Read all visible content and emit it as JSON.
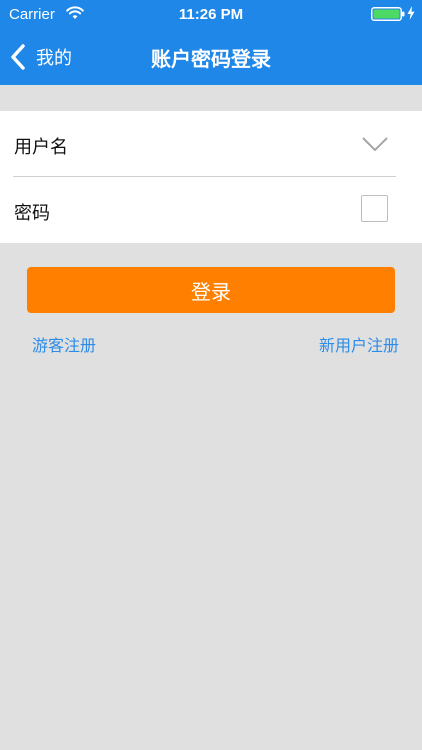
{
  "status_bar": {
    "carrier": "Carrier",
    "time": "11:26 PM"
  },
  "nav": {
    "back_label": "我的",
    "title": "账户密码登录"
  },
  "form": {
    "username_label": "用户名",
    "username_value": "",
    "password_label": "密码",
    "password_value": "",
    "remember_checked": false
  },
  "login_button": {
    "label": "登录"
  },
  "links": {
    "guest_register": "游客注册",
    "new_user_register": "新用户注册"
  },
  "colors": {
    "nav_background": "#1e87e8",
    "login_button": "#ff8000",
    "link": "#2d8ce8",
    "page_background": "#e0e0e0",
    "battery_fill": "#4cd964"
  },
  "icons": {
    "wifi": "wifi-icon",
    "battery": "battery-icon",
    "charging": "charging-bolt-icon",
    "back": "chevron-left-icon",
    "dropdown": "chevron-down-icon",
    "checkbox": "checkbox-icon"
  }
}
